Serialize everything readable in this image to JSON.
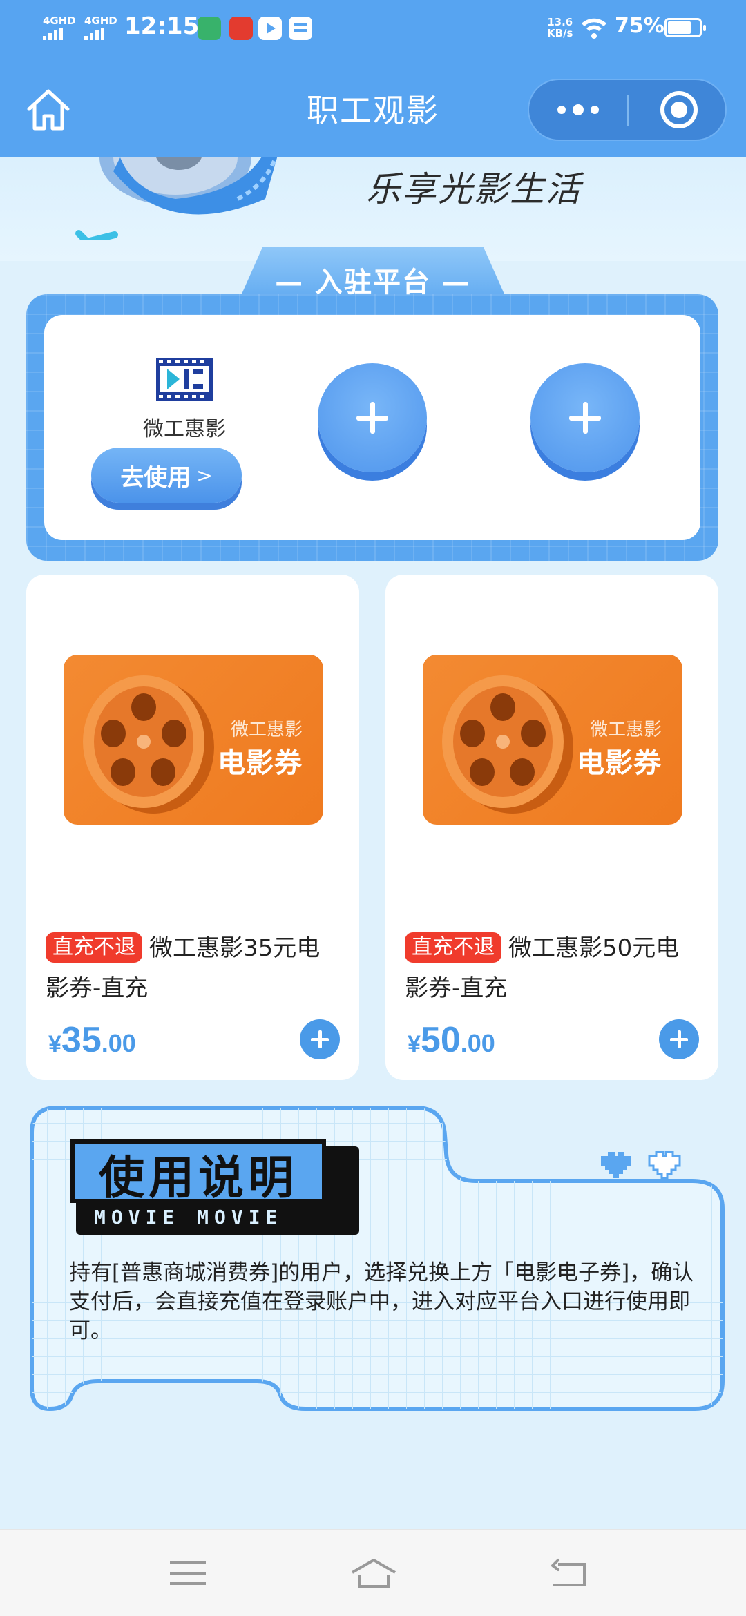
{
  "status_bar": {
    "signal1": "4GHD",
    "signal2": "4GHD",
    "time": "12:15",
    "net_speed_value": "13.6",
    "net_speed_unit": "KB/s",
    "battery": "75%",
    "battery_level": 0.75
  },
  "nav": {
    "title": "职工观影"
  },
  "banner": {
    "slogan": "乐享光影生活"
  },
  "platforms": {
    "heading": "— 入驻平台 —",
    "items": [
      {
        "name": "微工惠影",
        "action_label": "去使用",
        "action_arrow": ">"
      }
    ]
  },
  "products": [
    {
      "image_sub": "微工惠影",
      "image_main": "电影券",
      "tag": "直充不退",
      "title": "微工惠影35元电影券-直充",
      "price_symbol": "¥",
      "price_int": "35",
      "price_dec": ".00"
    },
    {
      "image_sub": "微工惠影",
      "image_main": "电影券",
      "tag": "直充不退",
      "title": "微工惠影50元电影券-直充",
      "price_symbol": "¥",
      "price_int": "50",
      "price_dec": ".00"
    }
  ],
  "usage": {
    "title": "使用说明",
    "subtitle": "MOVIE MOVIE",
    "text": "持有[普惠商城消费券]的用户，选择兑换上方「电影电子券]，确认支付后，会直接充值在登录账户中，进入对应平台入口进行使用即可。"
  },
  "colors": {
    "brand_blue": "#57a4f1",
    "accent_orange": "#f38a32",
    "tag_red": "#f03b2c",
    "price_blue": "#4a9ae8"
  }
}
